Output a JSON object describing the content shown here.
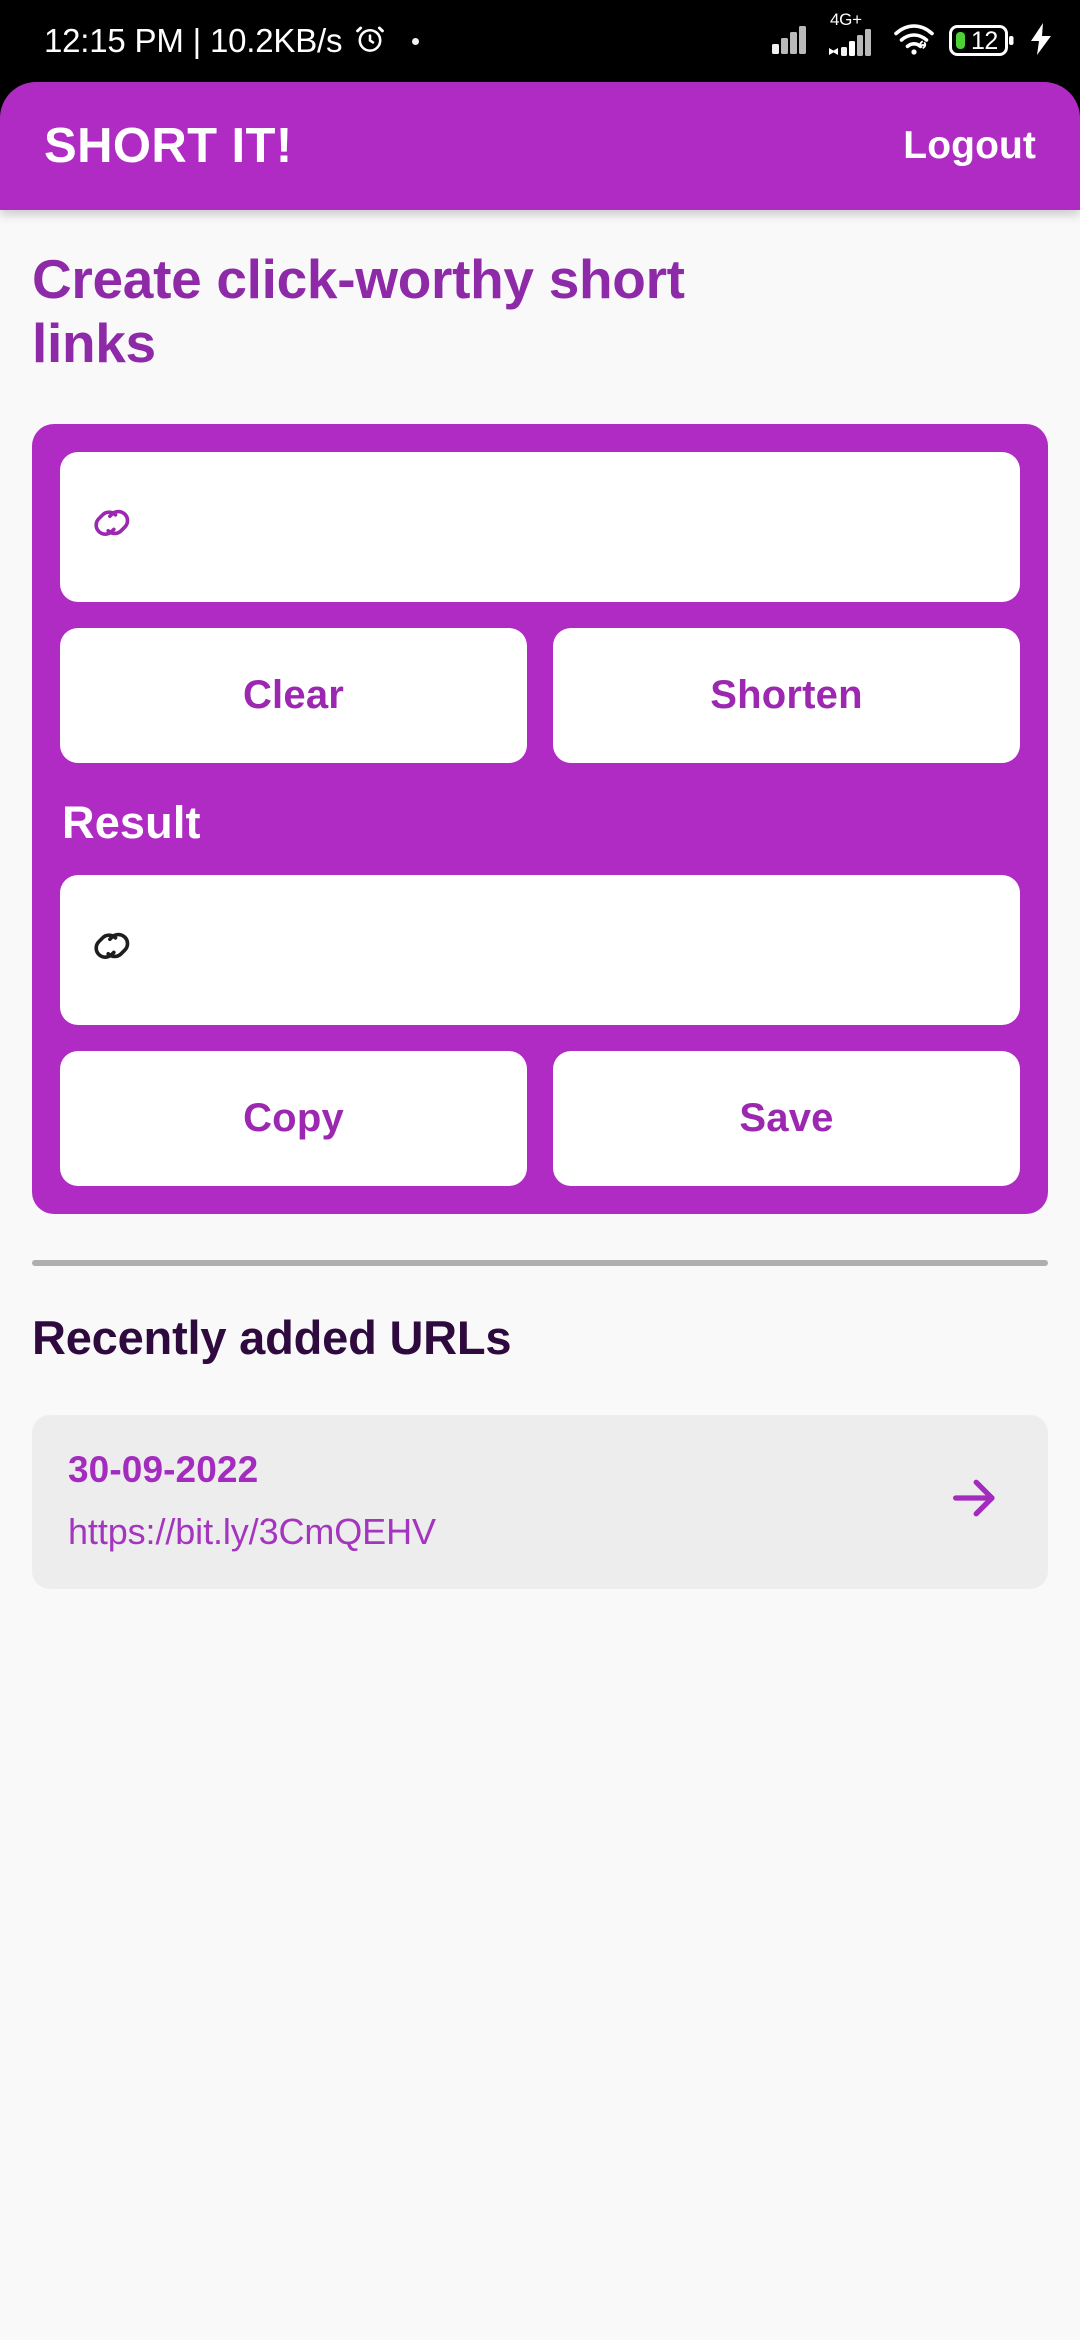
{
  "status_bar": {
    "clock": "12:15 PM | 10.2KB/s",
    "alarm_icon": "alarm-icon",
    "notification_dot": "notification-dot",
    "network_type": "4G+",
    "signal_icon": "signal-bars-icon",
    "signal_icon_2": "signal-bars-icon-sim2",
    "wifi_icon": "wifi-icon",
    "battery_level": "12",
    "battery_icon": "battery-icon",
    "charging_icon": "charging-bolt-icon"
  },
  "app_bar": {
    "title": "SHORT IT!",
    "logout_label": "Logout"
  },
  "main": {
    "heading": "Create click-worthy short links",
    "url_input": {
      "icon": "link-icon",
      "value": "",
      "placeholder": ""
    },
    "clear_label": "Clear",
    "shorten_label": "Shorten",
    "result_label": "Result",
    "result_input": {
      "icon": "link-icon",
      "value": "",
      "placeholder": ""
    },
    "copy_label": "Copy",
    "save_label": "Save"
  },
  "recent": {
    "heading": "Recently added URLs",
    "items": [
      {
        "date": "30-09-2022",
        "url": "https://bit.ly/3CmQEHV",
        "arrow_icon": "arrow-right-icon"
      }
    ]
  },
  "colors": {
    "brand_purple": "#B02BC4",
    "heading_purple": "#8E2AA8",
    "button_text_purple": "#9C27B0",
    "dark_purple": "#2E0A3E",
    "link_purple": "#A435BE",
    "page_bg": "#F9F9FA",
    "card_bg": "#EDEDEE",
    "battery_green": "#4CD137"
  }
}
